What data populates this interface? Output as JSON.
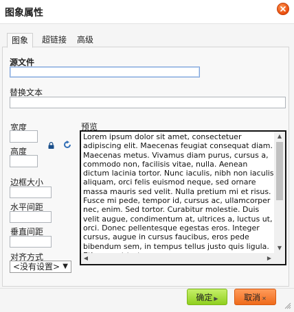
{
  "dialog": {
    "title": "图象属性",
    "close_icon": "close-icon"
  },
  "tabs": [
    {
      "label": "图象",
      "active": true
    },
    {
      "label": "超链接",
      "active": false
    },
    {
      "label": "高级",
      "active": false
    }
  ],
  "fields": {
    "source_label": "源文件",
    "source_value": "",
    "alt_label": "替换文本",
    "alt_value": "",
    "width_label": "宽度",
    "width_value": "",
    "height_label": "高度",
    "height_value": "",
    "border_label": "边框大小",
    "border_value": "",
    "hspace_label": "水平间距",
    "hspace_value": "",
    "vspace_label": "垂直间距",
    "vspace_value": "",
    "align_label": "对齐方式",
    "align_selected": "<没有设置>"
  },
  "icons": {
    "lock": "lock-icon",
    "reset": "reset-size-icon"
  },
  "preview": {
    "label": "预览",
    "text": "Lorem ipsum dolor sit amet, consectetuer adipiscing elit. Maecenas feugiat consequat diam. Maecenas metus. Vivamus diam purus, cursus a, commodo non, facilisis vitae, nulla. Aenean dictum lacinia tortor. Nunc iaculis, nibh non iaculis aliquam, orci felis euismod neque, sed ornare massa mauris sed velit. Nulla pretium mi et risus. Fusce mi pede, tempor id, cursus ac, ullamcorper nec, enim. Sed tortor. Curabitur molestie. Duis velit augue, condimentum at, ultrices a, luctus ut, orci. Donec pellentesque egestas eros. Integer cursus, augue in cursus faucibus, eros pede bibendum sem, in tempus tellus justo quis ligula. Etiam eget tortor."
  },
  "footer": {
    "ok_label": "确定",
    "cancel_label": "取消"
  },
  "colors": {
    "ok_button": "#9bd531",
    "cancel_button": "#f07428",
    "close_button": "#ef5b15"
  }
}
